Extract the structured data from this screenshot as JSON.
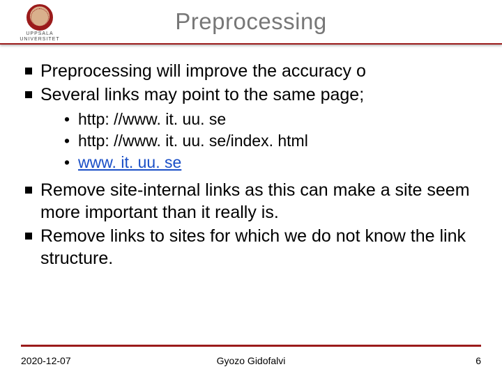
{
  "logo": {
    "line1": "UPPSALA",
    "line2": "UNIVERSITET"
  },
  "title": "Preprocessing",
  "bullets": {
    "b1": "Preprocessing will improve the accuracy o",
    "b2": "Several links may point to the same page;",
    "sub1": "http: //www. it. uu. se",
    "sub2": "http: //www. it. uu. se/index. html",
    "sub3": "www. it. uu. se",
    "b3": "Remove site-internal links as this can make a site seem more important than it really is.",
    "b4": "Remove links to sites for which we do not know the link structure."
  },
  "footer": {
    "date": "2020-12-07",
    "author": "Gyozo Gidofalvi",
    "page": "6"
  }
}
